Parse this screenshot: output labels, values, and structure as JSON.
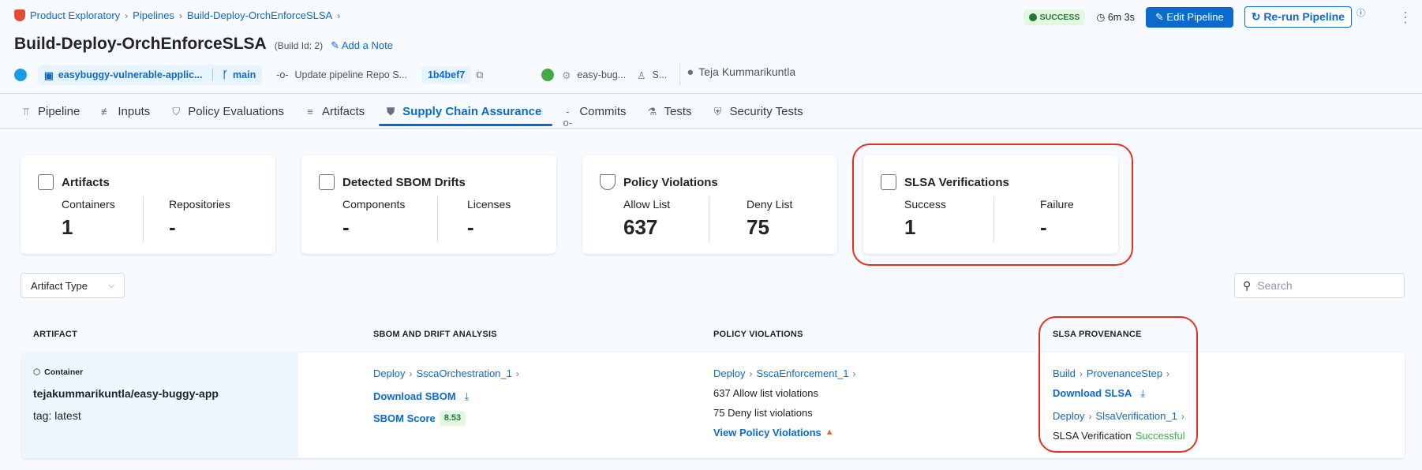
{
  "breadcrumb": {
    "items": [
      "Product Exploratory",
      "Pipelines",
      "Build-Deploy-OrchEnforceSLSA"
    ]
  },
  "header": {
    "title": "Build-Deploy-OrchEnforceSLSA",
    "build_id": "(Build Id: 2)",
    "add_note": "Add a Note",
    "status": "SUCCESS",
    "duration": "6m 3s",
    "edit_pipeline": "Edit Pipeline",
    "rerun_pipeline": "Re-run Pipeline"
  },
  "meta": {
    "repo": "easybuggy-vulnerable-applic...",
    "branch": "main",
    "commit_message": "Update pipeline Repo S...",
    "commit_hash": "1b4bef7",
    "service": "easy-bug...",
    "environment": "S...",
    "user": "Teja Kummarikuntla"
  },
  "tabs": [
    {
      "label": "Pipeline",
      "icon": "pipeline-icon"
    },
    {
      "label": "Inputs",
      "icon": "inputs-icon"
    },
    {
      "label": "Policy Evaluations",
      "icon": "shield-check-icon"
    },
    {
      "label": "Artifacts",
      "icon": "artifacts-icon"
    },
    {
      "label": "Supply Chain Assurance",
      "icon": "supply-chain-icon",
      "active": true
    },
    {
      "label": "Commits",
      "icon": "commit-icon"
    },
    {
      "label": "Tests",
      "icon": "flask-icon"
    },
    {
      "label": "Security Tests",
      "icon": "security-shield-icon"
    }
  ],
  "cards": [
    {
      "title": "Artifacts",
      "icon": "box-icon",
      "cols": [
        {
          "label": "Containers",
          "value": "1"
        },
        {
          "label": "Repositories",
          "value": "-"
        }
      ]
    },
    {
      "title": "Detected SBOM Drifts",
      "icon": "document-box-icon",
      "cols": [
        {
          "label": "Components",
          "value": "-"
        },
        {
          "label": "Licenses",
          "value": "-"
        }
      ]
    },
    {
      "title": "Policy Violations",
      "icon": "shield-check-icon",
      "cols": [
        {
          "label": "Allow List",
          "value": "637"
        },
        {
          "label": "Deny List",
          "value": "75"
        }
      ]
    },
    {
      "title": "SLSA Verifications",
      "icon": "slsa-icon",
      "cols": [
        {
          "label": "Success",
          "value": "1"
        },
        {
          "label": "Failure",
          "value": "-"
        }
      ]
    }
  ],
  "filters": {
    "artifact_type": "Artifact Type",
    "search_placeholder": "Search"
  },
  "table": {
    "headers": [
      "ARTIFACT",
      "SBOM AND DRIFT ANALYSIS",
      "POLICY VIOLATIONS",
      "SLSA PROVENANCE"
    ],
    "row": {
      "artifact": {
        "type": "Container",
        "name": "tejakummarikuntla/easy-buggy-app",
        "tag": "tag: latest"
      },
      "sbom": {
        "stage": "Deploy",
        "step": "SscaOrchestration_1",
        "download": "Download SBOM",
        "score_label": "SBOM Score",
        "score": "8.53"
      },
      "policy": {
        "stage": "Deploy",
        "step": "SscaEnforcement_1",
        "allow": "637 Allow list violations",
        "deny": "75 Deny list violations",
        "view": "View Policy Violations"
      },
      "slsa": {
        "stage": "Build",
        "step": "ProvenanceStep",
        "download": "Download SLSA",
        "verify_stage": "Deploy",
        "verify_step": "SlsaVerification_1",
        "verification_label": "SLSA Verification",
        "verification_status": "Successful"
      }
    }
  },
  "colors": {
    "accent": "#0b6acb",
    "success": "#42ab45",
    "highlight": "#e5311c"
  }
}
